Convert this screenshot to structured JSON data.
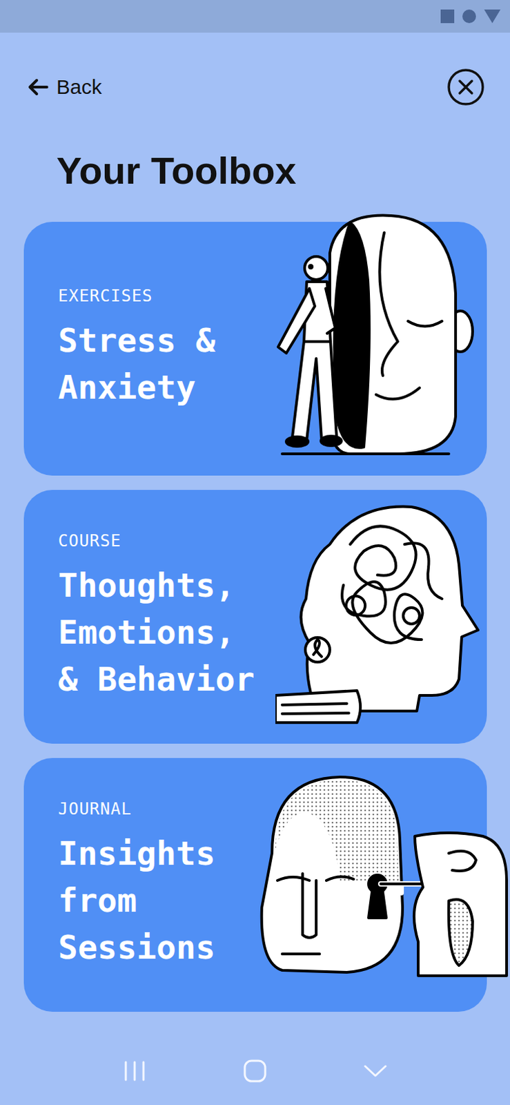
{
  "header": {
    "back_label": "Back",
    "title": "Your Toolbox"
  },
  "cards": [
    {
      "category": "EXERCISES",
      "lines": [
        "Stress &",
        "Anxiety"
      ]
    },
    {
      "category": "COURSE",
      "lines": [
        "Thoughts,",
        "Emotions,",
        "& Behavior"
      ]
    },
    {
      "category": "JOURNAL",
      "lines": [
        "Insights",
        "from",
        "Sessions"
      ]
    }
  ]
}
